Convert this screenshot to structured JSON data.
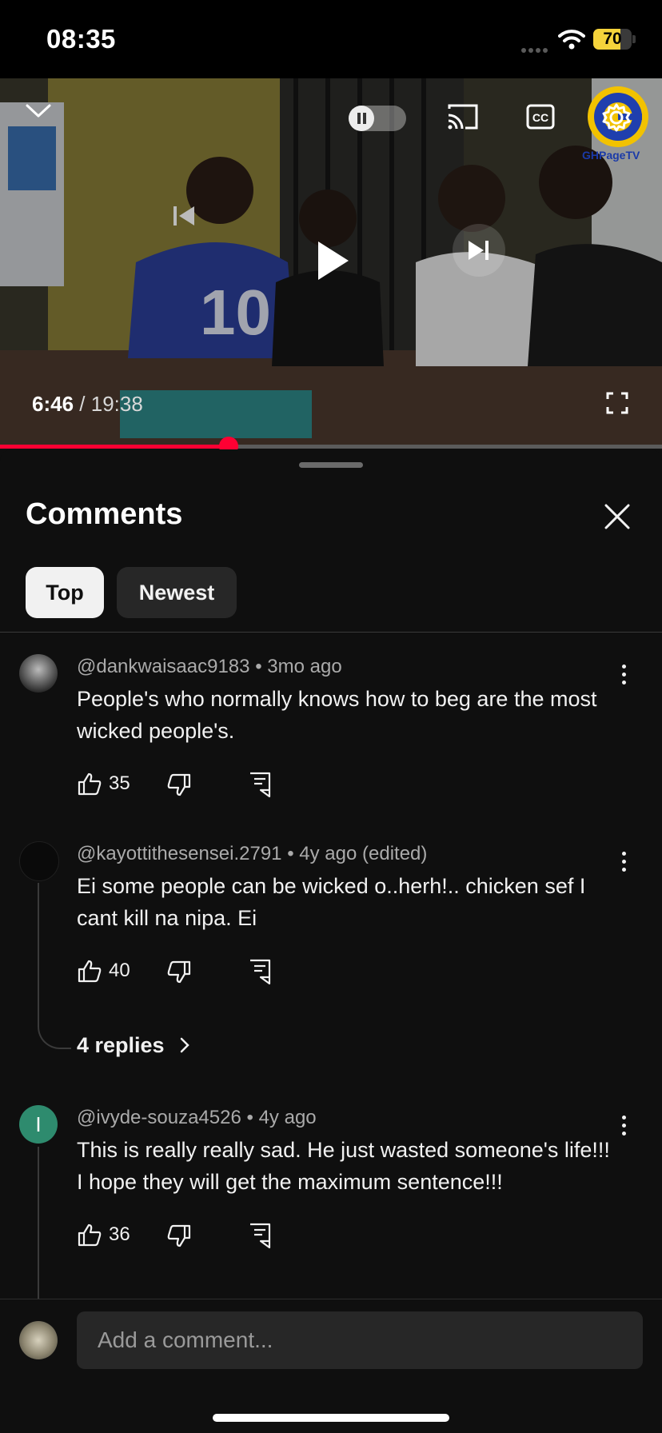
{
  "status_bar": {
    "time": "08:35",
    "battery": "70",
    "battery_level": 0.7
  },
  "player": {
    "elapsed": "6:46",
    "duration": "/ 19:38",
    "progress_fraction": 0.345,
    "channel_watermark": "GHPageTV",
    "icons": [
      "chevron-down-icon",
      "autoplay-toggle-icon",
      "cast-icon",
      "cc-icon",
      "settings-icon",
      "previous-icon",
      "play-icon",
      "next-icon",
      "fullscreen-icon"
    ]
  },
  "comments_panel": {
    "title": "Comments",
    "filters": [
      "Top",
      "Newest"
    ],
    "selected_filter": "Top",
    "comments": [
      {
        "author": "@dankwaisaac9183",
        "age": "3mo ago",
        "text": "People's who normally knows how to beg are the most wicked people's.",
        "likes": "35"
      },
      {
        "author": "@kayottithesensei.2791",
        "age": "4y ago (edited)",
        "text": "Ei some people can be wicked o..herh!.. chicken sef I cant kill na nipa. Ei",
        "likes": "40",
        "replies": "4 replies"
      },
      {
        "author": "@ivyde-souza4526",
        "age": "4y ago",
        "avatar_letter": "I",
        "text": "This is really really sad. He just wasted someone's life!!! I hope they will get the maximum sentence!!!",
        "likes": "36"
      }
    ],
    "meta_separator": "•",
    "add_comment_placeholder": "Add a comment..."
  },
  "colors": {
    "accent": "#ff0033",
    "background": "#0f0f0f",
    "chip_selected": "#f1f1f1",
    "chip": "#272727",
    "ivy_avatar": "#2e8b6e"
  }
}
